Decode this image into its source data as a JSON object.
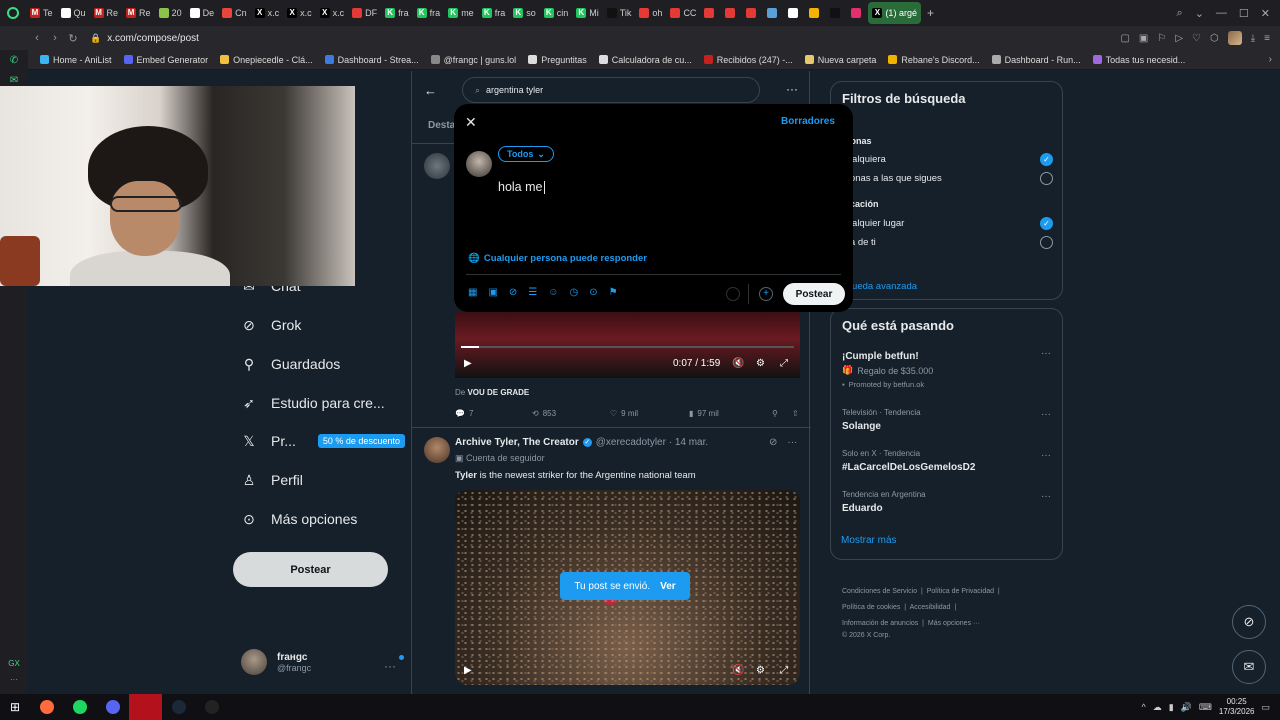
{
  "browser": {
    "tabs": [
      {
        "label": "Te",
        "color": "#c5221f",
        "glyph": "M"
      },
      {
        "label": "Qu",
        "color": "#ffffff",
        "glyph": ""
      },
      {
        "label": "Re",
        "color": "#c5221f",
        "glyph": "M"
      },
      {
        "label": "Re",
        "color": "#c5221f",
        "glyph": "M"
      },
      {
        "label": "20",
        "color": "#8bc34a",
        "glyph": ""
      },
      {
        "label": "De",
        "color": "#ffffff",
        "glyph": ""
      },
      {
        "label": "Cn",
        "color": "#e8453c",
        "glyph": ""
      },
      {
        "label": "x.c",
        "color": "#000000",
        "glyph": "X"
      },
      {
        "label": "x.c",
        "color": "#000000",
        "glyph": "X"
      },
      {
        "label": "x.c",
        "color": "#000000",
        "glyph": "X"
      },
      {
        "label": "DF",
        "color": "#e53935",
        "glyph": ""
      },
      {
        "label": "fra",
        "color": "#22c55e",
        "glyph": "K"
      },
      {
        "label": "fra",
        "color": "#22c55e",
        "glyph": "K"
      },
      {
        "label": "me",
        "color": "#22c55e",
        "glyph": "K"
      },
      {
        "label": "fra",
        "color": "#22c55e",
        "glyph": "K"
      },
      {
        "label": "so",
        "color": "#22c55e",
        "glyph": "K"
      },
      {
        "label": "cin",
        "color": "#22c55e",
        "glyph": "K"
      },
      {
        "label": "Mi",
        "color": "#22c55e",
        "glyph": "K"
      },
      {
        "label": "Tik",
        "color": "#111111",
        "glyph": ""
      },
      {
        "label": "oh",
        "color": "#e53935",
        "glyph": ""
      },
      {
        "label": "CC",
        "color": "#e53935",
        "glyph": ""
      },
      {
        "label": "",
        "color": "#e53935",
        "glyph": ""
      },
      {
        "label": "",
        "color": "#e53935",
        "glyph": ""
      },
      {
        "label": "",
        "color": "#e53935",
        "glyph": ""
      },
      {
        "label": "",
        "color": "#5aa0d8",
        "glyph": ""
      },
      {
        "label": "",
        "color": "#ffffff",
        "glyph": ""
      },
      {
        "label": "",
        "color": "#f5b400",
        "glyph": ""
      },
      {
        "label": "",
        "color": "#111111",
        "glyph": ""
      },
      {
        "label": "",
        "color": "#e1306c",
        "glyph": ""
      }
    ],
    "active_tab": "(1) argé",
    "new_tab": "+",
    "url": "x.com/compose/post",
    "bookmarks": [
      {
        "label": "Home - AniList",
        "color": "#3db4f2"
      },
      {
        "label": "Embed Generator",
        "color": "#5865f2"
      },
      {
        "label": "Onepiecedle - Clá...",
        "color": "#f0c040"
      },
      {
        "label": "Dashboard - Strea...",
        "color": "#3d7be0"
      },
      {
        "label": "@frangc | guns.lol",
        "color": "#888888"
      },
      {
        "label": "Preguntitas",
        "color": "#dddddd"
      },
      {
        "label": "Calculadora de cu...",
        "color": "#dddddd"
      },
      {
        "label": "Recibidos (247) -...",
        "color": "#c5221f"
      },
      {
        "label": "Nueva carpeta",
        "color": "#e6c86e"
      },
      {
        "label": "Rebane's Discord...",
        "color": "#f0b400"
      },
      {
        "label": "Dashboard - Run...",
        "color": "#aaaaaa"
      },
      {
        "label": "Todas tus necesid...",
        "color": "#9c6ade"
      }
    ]
  },
  "x": {
    "nav": {
      "chat": "Chat",
      "grok": "Grok",
      "bookmarks": "Guardados",
      "studio": "Estudio para cre...",
      "premium": "Pr...",
      "premium_badge": "50 % de descuento",
      "profile": "Perfil",
      "more": "Más opciones",
      "post": "Postear"
    },
    "user": {
      "name": "frанgc",
      "handle": "@frangc"
    },
    "search": {
      "query": "argentina tyler",
      "tab": "Desta",
      "partial_s": "s"
    },
    "video1": {
      "time": "0:07 / 1:59",
      "from_prefix": "De",
      "from": "VOU DE GRADE",
      "replies": "7",
      "reposts": "853",
      "likes": "9 mil",
      "views": "97 mil"
    },
    "tweet2": {
      "name": "Archive Tyler, The Creator",
      "handle": "@xerecadotyler · 14 mar.",
      "sub": "Cuenta de seguidor",
      "text_bold": "Tyler",
      "text": " is the newest striker for the Argentine national team"
    },
    "toast": {
      "text": "Tu post se envió.",
      "action": "Ver"
    },
    "filters": {
      "title": "Filtros de búsqueda",
      "people_title": "rsonas",
      "people_opt1": "cualquiera",
      "people_opt2": "rsonas a las que sigues",
      "location_title": "bicación",
      "location_opt1": "cualquier lugar",
      "location_opt2": "rca de ti",
      "advanced": "squeda avanzada"
    },
    "trends": {
      "title": "Qué está pasando",
      "promo_title": "¡Cumple betfun!",
      "promo_sub": "Regalo de $35.000",
      "promo_by": "Promoted by betfun.ok",
      "items": [
        {
          "meta": "Televisión · Tendencia",
          "title": "Solange"
        },
        {
          "meta": "Solo en X · Tendencia",
          "title": "#LaCarcelDeLosGemelosD2"
        },
        {
          "meta": "Tendencia en Argentina",
          "title": "Eduardo"
        }
      ],
      "more": "Mostrar más"
    },
    "footer": {
      "l1": "Condiciones de Servicio",
      "l2": "Política de Privacidad",
      "l3": "Política de cookies",
      "l4": "Accesibilidad",
      "l5": "Información de anuncios",
      "l6": "Más opciones ···",
      "copy": "© 2026 X Corp."
    },
    "compose": {
      "drafts": "Borradores",
      "audience": "Todos",
      "text": "hola me",
      "reply_setting": "Cualquier persona puede responder",
      "post": "Postear"
    }
  },
  "taskbar": {
    "apps": [
      {
        "color": "#ff6b3d"
      },
      {
        "color": "#1ed760"
      },
      {
        "color": "#5865f2"
      },
      {
        "color": "#b3121d"
      },
      {
        "color": "#1b2838"
      },
      {
        "color": "#222222"
      }
    ],
    "time": "00:25",
    "date": "17/3/2026"
  }
}
